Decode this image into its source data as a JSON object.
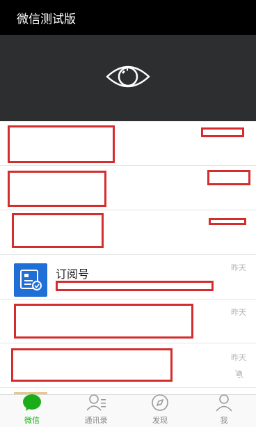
{
  "app": {
    "title": "微信测试版"
  },
  "colors": {
    "accent": "#1aad19",
    "redaction": "#d42d2d",
    "subscription_icon": "#1f6fd6"
  },
  "hero": {
    "icon": "eye-icon"
  },
  "chat_list": [
    {
      "name": "",
      "time": ""
    },
    {
      "name": "",
      "time": ""
    },
    {
      "name": "",
      "time": ""
    },
    {
      "name": "订阅号",
      "time": "昨天",
      "icon": "subscription-icon"
    },
    {
      "name": "",
      "time": "昨天"
    },
    {
      "name": "",
      "time": "昨天",
      "muted_icon": "mute-bell-icon"
    }
  ],
  "tabs": [
    {
      "label": "微信",
      "icon": "chat-bubble-icon",
      "active": true
    },
    {
      "label": "通讯录",
      "icon": "contacts-icon",
      "active": false
    },
    {
      "label": "发现",
      "icon": "compass-icon",
      "active": false
    },
    {
      "label": "我",
      "icon": "person-icon",
      "active": false
    }
  ]
}
